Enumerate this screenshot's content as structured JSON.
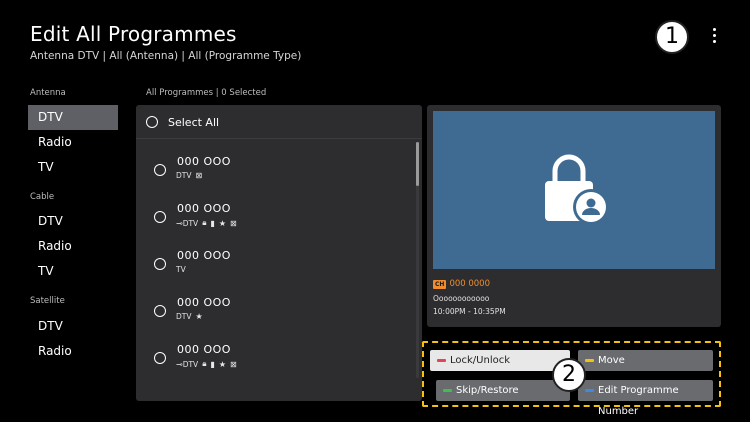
{
  "header": {
    "title": "Edit All Programmes",
    "subtitle": "Antenna DTV | All (Antenna) | All (Programme Type)"
  },
  "callouts": [
    "1",
    "2"
  ],
  "sidebar": {
    "sections": [
      {
        "label": "Antenna",
        "items": [
          "DTV",
          "Radio",
          "TV"
        ],
        "active_index": 0
      },
      {
        "label": "Cable",
        "items": [
          "DTV",
          "Radio",
          "TV"
        ]
      },
      {
        "label": "Satellite",
        "items": [
          "DTV",
          "Radio"
        ]
      }
    ]
  },
  "list": {
    "header": "All Programmes  |  0 Selected",
    "select_all_label": "Select All",
    "rows": [
      {
        "name": "000  OOO",
        "meta": "DTV",
        "icons": [
          "box-x-icon"
        ]
      },
      {
        "name": "000  OOO",
        "meta": "DTV",
        "icons": [
          "antenna-arrow-icon",
          "lock-icon",
          "bookmark-icon",
          "star-icon",
          "box-x-icon"
        ]
      },
      {
        "name": "000  OOO",
        "meta": "TV",
        "icons": []
      },
      {
        "name": "000  OOO",
        "meta": "DTV",
        "icons": [
          "star-icon"
        ]
      },
      {
        "name": "000  OOO",
        "meta": "DTV",
        "icons": [
          "antenna-arrow-icon",
          "lock-icon",
          "bookmark-icon",
          "star-icon",
          "box-x-icon"
        ]
      }
    ]
  },
  "preview": {
    "channel_badge": "CH",
    "channel": "000 0000",
    "programme": "Oooooooooooo",
    "time": "10:00PM - 10:35PM",
    "screen_color": "#3f6b92"
  },
  "buttons": {
    "red": {
      "label": "Lock/Unlock",
      "color": "#e0455a"
    },
    "yellow": {
      "label": "Move",
      "color": "#f4c20d"
    },
    "green": {
      "label": "Skip/Restore",
      "color": "#3fbf4f"
    },
    "blue": {
      "label": "Edit Programme Number",
      "color": "#3b8be0"
    }
  }
}
